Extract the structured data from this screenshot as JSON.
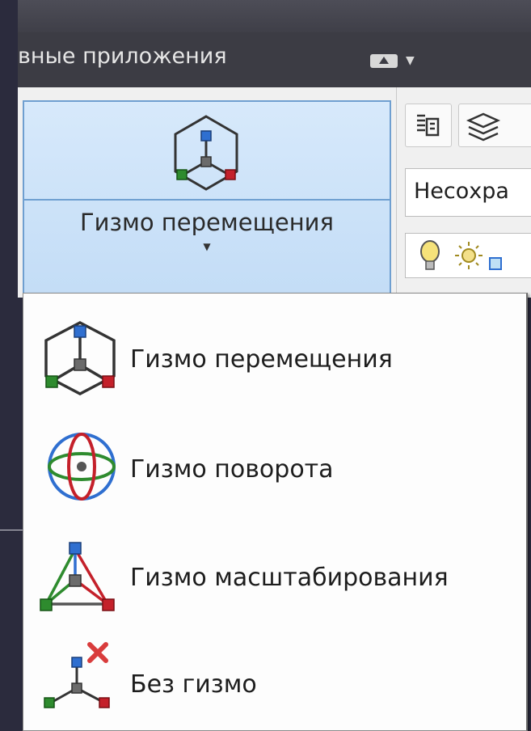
{
  "tabbar": {
    "tab_label": "вные приложения"
  },
  "ribbon": {
    "big_button_label": "Гизмо перемещения",
    "visual_style_value": "Несохра"
  },
  "menu": {
    "items": [
      {
        "label": "Гизмо перемещения",
        "icon": "move-gizmo-icon"
      },
      {
        "label": "Гизмо поворота",
        "icon": "rotate-gizmo-icon"
      },
      {
        "label": "Гизмо масштабирования",
        "icon": "scale-gizmo-icon"
      },
      {
        "label": "Без гизмо",
        "icon": "no-gizmo-icon"
      }
    ]
  },
  "colors": {
    "axis_x": "#c4202a",
    "axis_y": "#2e8b2e",
    "axis_z": "#2f6fd0",
    "selected_bg": "#cfe3f8"
  }
}
